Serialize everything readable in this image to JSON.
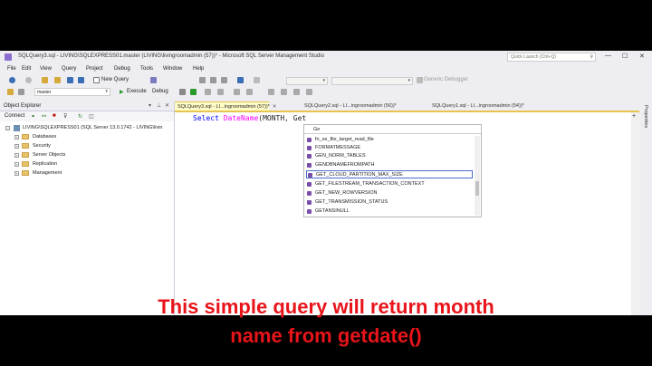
{
  "window": {
    "title": "SQLQuery3.sql - LIVING\\SQLEXPRESS01.master (LIVING\\livingroomadmin (57))* - Microsoft SQL Server Management Studio",
    "quick_launch_placeholder": "Quick Launch (Ctrl+Q)"
  },
  "menu": [
    "File",
    "Edit",
    "View",
    "Query",
    "Project",
    "Debug",
    "Tools",
    "Window",
    "Help"
  ],
  "toolbar": {
    "new_query": "New Query",
    "debugger": "Generic Debugger",
    "database": "master",
    "execute": "Execute",
    "debug": "Debug"
  },
  "object_explorer": {
    "title": "Object Explorer",
    "connect": "Connect",
    "server": "LIVING\\SQLEXPRESS01 (SQL Server 13.0.1742 - LIVING\\livin",
    "nodes": [
      "Databases",
      "Security",
      "Server Objects",
      "Replication",
      "Management"
    ]
  },
  "tabs": [
    {
      "label": "SQLQuery3.sql - LI...ingroomadmin (57))*",
      "active": true
    },
    {
      "label": "SQLQuery2.sql - LI...ingroomadmin (56))*",
      "active": false
    },
    {
      "label": "SQLQuery1.sql - LI...ingroomadmin (54))*",
      "active": false
    }
  ],
  "editor": {
    "kw_select": "Select",
    "fn_datename": "DateName",
    "args": "(MONTH, Get"
  },
  "intellisense": {
    "typed": "Ge",
    "items": [
      "fn_xe_file_target_read_file",
      "FORMATMESSAGE",
      "GEN_NORM_TABLES",
      "GENDBNAMEFROMPATH",
      "GET_CLOUD_PARTITION_MAX_SIZE",
      "GET_FILESTREAM_TRANSACTION_CONTEXT",
      "GET_NEW_ROWVERSION",
      "GET_TRANSMISSION_STATUS",
      "GETANSINULL"
    ],
    "selected_index": 4
  },
  "properties_label": "Properties",
  "caption": {
    "line1": "This simple query will return month",
    "line2": "name from getdate()"
  }
}
